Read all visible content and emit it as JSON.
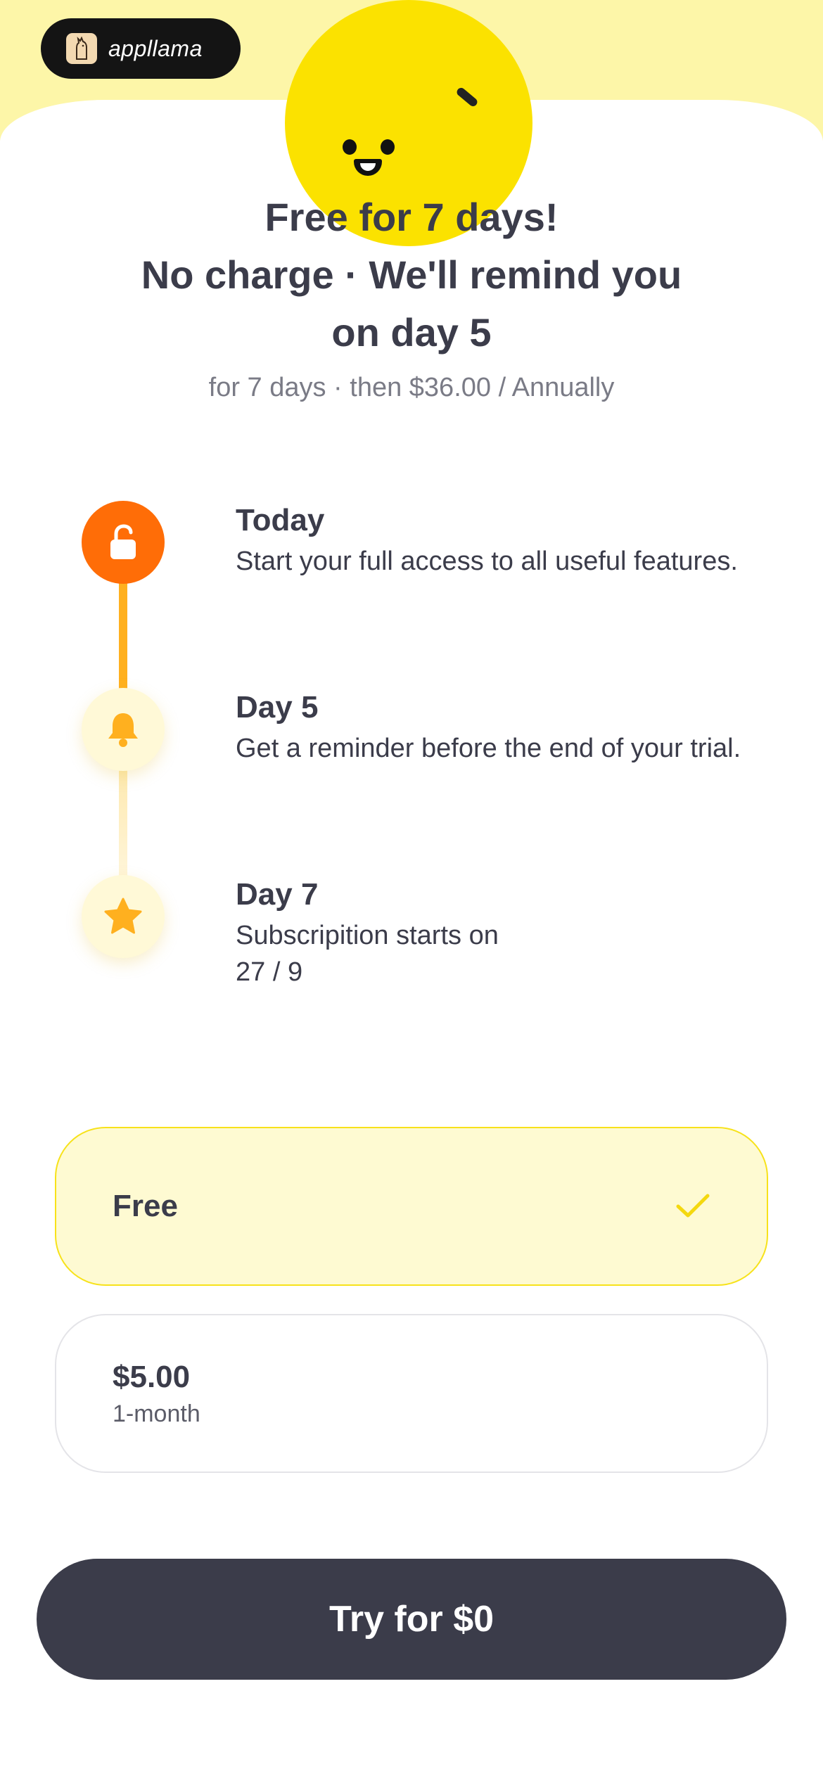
{
  "brand": {
    "name": "appllama",
    "logo_icon": "llama-logo-icon",
    "mascot_icon": "smiley-mascot-icon"
  },
  "header": {
    "title_lines": [
      "Free for 7 days!",
      "No charge · We'll remind you",
      "on day 5"
    ],
    "subtitle": "for 7 days · then $36.00 / Annually"
  },
  "timeline": [
    {
      "title": "Today",
      "description": "Start your full access to all useful features.",
      "icon": "unlock-icon"
    },
    {
      "title": "Day 5",
      "description": "Get a reminder before the end of your trial.",
      "icon": "bell-icon"
    },
    {
      "title": "Day 7",
      "description_line1": "Subscripition starts on",
      "description_line2": "27 / 9",
      "icon": "star-icon"
    }
  ],
  "plans": [
    {
      "label": "Free",
      "selected": true
    },
    {
      "label": "$5.00",
      "period": "1-month",
      "selected": false
    }
  ],
  "cta": {
    "label": "Try for $0"
  },
  "colors": {
    "accent_yellow": "#fbe200",
    "header_bg": "#fdf6a8",
    "active_orange": "#ff6d07",
    "timeline_amber": "#ffb01f",
    "text_dark": "#3b3c4a",
    "selected_bg": "#fefad2"
  }
}
